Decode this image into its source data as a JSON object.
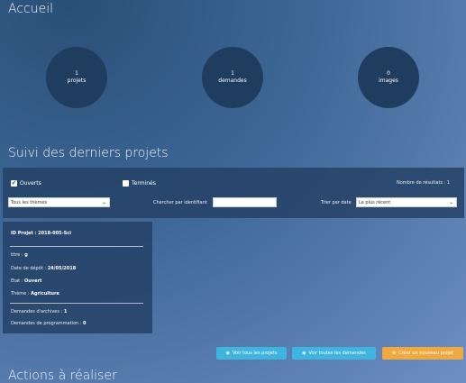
{
  "header": {
    "title": "Accueil"
  },
  "stats": [
    {
      "count": "1",
      "label": "projets"
    },
    {
      "count": "1",
      "label": "demandes"
    },
    {
      "count": "0",
      "label": "images"
    }
  ],
  "recent": {
    "title": "Suivi des derniers projets"
  },
  "filters": {
    "ouverts_label": "Ouverts",
    "termines_label": "Terminés",
    "results_label": "Nombre de résultats : 1",
    "theme_value": "Tous les thèmes",
    "search_label": "Chercher par identifiant",
    "sort_label": "Trier par date",
    "sort_value": "Le plus récent"
  },
  "project": {
    "id_label": "ID Projet :",
    "id_value": "2018-005-Sci",
    "titre_label": "titre :",
    "titre_value": "g",
    "date_label": "Date de dépôt :",
    "date_value": "24/05/2018",
    "etat_label": "Etat :",
    "etat_value": "Ouvert",
    "theme_label": "Thème :",
    "theme_value": "Agriculture",
    "archives_label": "Demandes d'archives :",
    "archives_value": "1",
    "prog_label": "Demandes de programmation :",
    "prog_value": "0"
  },
  "buttons": {
    "projets": "Voir tous les projets",
    "demandes": "Voir toutes les demandes",
    "nouveau": "Créer un nouveau projet"
  },
  "actions": {
    "title": "Actions à réaliser"
  },
  "colors": {
    "accent_blue": "#3fb4df",
    "accent_orange": "#f0a841"
  }
}
